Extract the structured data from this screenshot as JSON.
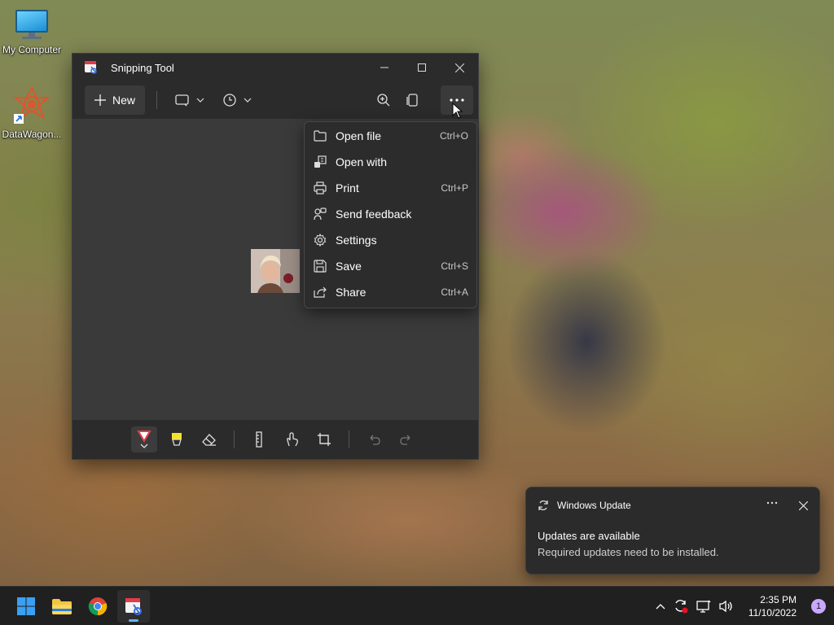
{
  "desktop": {
    "icons": [
      {
        "label": "My Computer",
        "icon": "monitor-icon"
      },
      {
        "label": "DataWagon...",
        "icon": "datawagon-icon"
      }
    ]
  },
  "window": {
    "title": "Snipping Tool",
    "app_icon": "snipping-tool-icon",
    "toolbar": {
      "new_label": "New"
    }
  },
  "menu": {
    "items": [
      {
        "label": "Open file",
        "shortcut": "Ctrl+O",
        "icon": "folder-icon"
      },
      {
        "label": "Open with",
        "shortcut": "",
        "icon": "open-with-icon"
      },
      {
        "label": "Print",
        "shortcut": "Ctrl+P",
        "icon": "printer-icon"
      },
      {
        "label": "Send feedback",
        "shortcut": "",
        "icon": "feedback-icon"
      },
      {
        "label": "Settings",
        "shortcut": "",
        "icon": "gear-icon"
      },
      {
        "label": "Save",
        "shortcut": "Ctrl+S",
        "icon": "save-icon"
      },
      {
        "label": "Share",
        "shortcut": "Ctrl+A",
        "icon": "share-icon"
      }
    ]
  },
  "toast": {
    "app": "Windows Update",
    "title": "Updates are available",
    "message": "Required updates need to be installed."
  },
  "taskbar": {
    "apps": [
      "windows-start-icon",
      "file-explorer-icon",
      "chrome-icon",
      "snipping-tool-icon"
    ],
    "time": "2:35 PM",
    "date": "11/10/2022",
    "notification_count": "1"
  },
  "colors": {
    "window_bg": "#2b2b2b",
    "canvas_bg": "#3a3a3a",
    "accent": "#66b3ff"
  }
}
